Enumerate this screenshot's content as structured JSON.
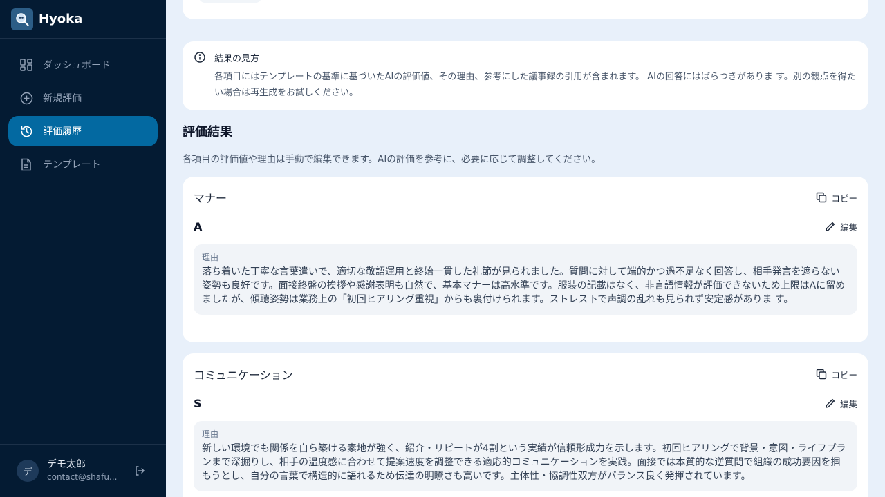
{
  "app": {
    "name": "Hyoka"
  },
  "sidebar": {
    "items": [
      {
        "label": "ダッシュボード",
        "icon": "dashboard-icon"
      },
      {
        "label": "新規評価",
        "icon": "plus-circle-icon"
      },
      {
        "label": "評価履歴",
        "icon": "history-icon",
        "active": true
      },
      {
        "label": "テンプレート",
        "icon": "document-icon"
      }
    ]
  },
  "user": {
    "avatar": "デ",
    "name": "デモ太郎",
    "email": "contact@shafu..."
  },
  "info": {
    "title": "結果の見方",
    "body": "各項目にはテンプレートの基準に基づいたAIの評価値、その理由、参考にした議事録の引用が含まれます。 AIの回答にはばらつきがありま す。別の観点を得たい場合は再生成をお試しください。"
  },
  "results": {
    "title": "評価結果",
    "description": "各項目の評価値や理由は手動で編集できます。AIの評価を参考に、必要に応じて調整してください。",
    "copy_label": "コピー",
    "edit_label": "編集",
    "reason_label": "理由",
    "items": [
      {
        "name": "マナー",
        "grade": "A",
        "reason": "落ち着いた丁寧な言葉遣いで、適切な敬語運用と終始一貫した礼節が見られました。質問に対して端的かつ過不足なく回答し、相手発言を遮らない姿勢も良好です。面接終盤の挨拶や感謝表明も自然で、基本マナーは高水準です。服装の記載はなく、非言語情報が評価できないため上限はAに留めましたが、傾聴姿勢は業務上の「初回ヒアリング重視」からも裏付けられます。ストレス下で声調の乱れも見られず安定感がありま す。"
      },
      {
        "name": "コミュニケーション",
        "grade": "S",
        "reason": "新しい環境でも関係を自ら築ける素地が強く、紹介・リピートが4割という実績が信頼形成力を示します。初回ヒアリングで背景・意図・ライフプランまで深掘りし、相手の温度感に合わせて提案速度を調整できる適応的コミュニケーションを実践。面接では本質的な逆質問で組織の成功要因を掴もうとし、自分の言葉で構造的に語れるため伝達の明瞭さも高いです。主体性・協調性双方がバランス良く発揮されています。"
      }
    ]
  },
  "colors": {
    "sidebar_bg": "#041b33",
    "active_bg": "#0369a1",
    "page_bg": "#e8f0fa"
  }
}
